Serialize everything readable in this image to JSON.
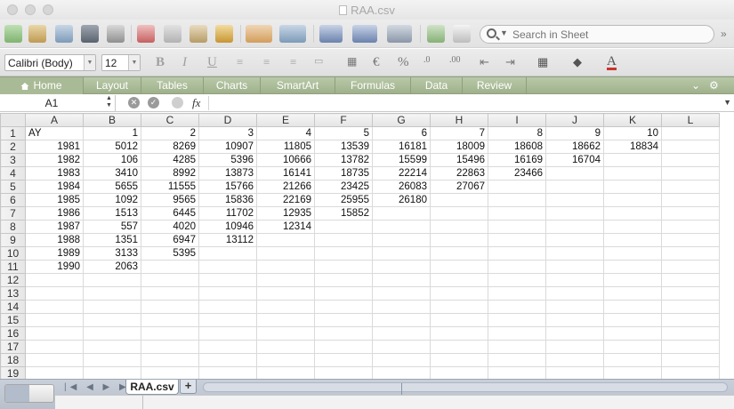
{
  "window": {
    "title": "RAA.csv"
  },
  "toolbar": {
    "search_placeholder": "Search in Sheet"
  },
  "format": {
    "font_name": "Calibri (Body)",
    "font_size": "12"
  },
  "ribbon": {
    "tabs": [
      "Home",
      "Layout",
      "Tables",
      "Charts",
      "SmartArt",
      "Formulas",
      "Data",
      "Review"
    ]
  },
  "formula_bar": {
    "name_box": "A1",
    "fx_label": "fx",
    "formula": ""
  },
  "sheet": {
    "columns": [
      "A",
      "B",
      "C",
      "D",
      "E",
      "F",
      "G",
      "H",
      "I",
      "J",
      "K",
      "L"
    ],
    "rows": [
      [
        "AY",
        "1",
        "2",
        "3",
        "4",
        "5",
        "6",
        "7",
        "8",
        "9",
        "10",
        ""
      ],
      [
        "1981",
        "5012",
        "8269",
        "10907",
        "11805",
        "13539",
        "16181",
        "18009",
        "18608",
        "18662",
        "18834",
        ""
      ],
      [
        "1982",
        "106",
        "4285",
        "5396",
        "10666",
        "13782",
        "15599",
        "15496",
        "16169",
        "16704",
        "",
        ""
      ],
      [
        "1983",
        "3410",
        "8992",
        "13873",
        "16141",
        "18735",
        "22214",
        "22863",
        "23466",
        "",
        "",
        ""
      ],
      [
        "1984",
        "5655",
        "11555",
        "15766",
        "21266",
        "23425",
        "26083",
        "27067",
        "",
        "",
        "",
        ""
      ],
      [
        "1985",
        "1092",
        "9565",
        "15836",
        "22169",
        "25955",
        "26180",
        "",
        "",
        "",
        "",
        ""
      ],
      [
        "1986",
        "1513",
        "6445",
        "11702",
        "12935",
        "15852",
        "",
        "",
        "",
        "",
        "",
        ""
      ],
      [
        "1987",
        "557",
        "4020",
        "10946",
        "12314",
        "",
        "",
        "",
        "",
        "",
        "",
        ""
      ],
      [
        "1988",
        "1351",
        "6947",
        "13112",
        "",
        "",
        "",
        "",
        "",
        "",
        "",
        ""
      ],
      [
        "1989",
        "3133",
        "5395",
        "",
        "",
        "",
        "",
        "",
        "",
        "",
        "",
        ""
      ],
      [
        "1990",
        "2063",
        "",
        "",
        "",
        "",
        "",
        "",
        "",
        "",
        "",
        ""
      ],
      [
        "",
        "",
        "",
        "",
        "",
        "",
        "",
        "",
        "",
        "",
        "",
        ""
      ],
      [
        "",
        "",
        "",
        "",
        "",
        "",
        "",
        "",
        "",
        "",
        "",
        ""
      ],
      [
        "",
        "",
        "",
        "",
        "",
        "",
        "",
        "",
        "",
        "",
        "",
        ""
      ],
      [
        "",
        "",
        "",
        "",
        "",
        "",
        "",
        "",
        "",
        "",
        "",
        ""
      ],
      [
        "",
        "",
        "",
        "",
        "",
        "",
        "",
        "",
        "",
        "",
        "",
        ""
      ],
      [
        "",
        "",
        "",
        "",
        "",
        "",
        "",
        "",
        "",
        "",
        "",
        ""
      ],
      [
        "",
        "",
        "",
        "",
        "",
        "",
        "",
        "",
        "",
        "",
        "",
        ""
      ],
      [
        "",
        "",
        "",
        "",
        "",
        "",
        "",
        "",
        "",
        "",
        "",
        ""
      ]
    ]
  },
  "sheet_tabs": {
    "active": "RAA.csv",
    "add_label": "+"
  },
  "colors": {
    "ribbon": "#a9bb96",
    "sheetbar": "#b7c0cc"
  }
}
